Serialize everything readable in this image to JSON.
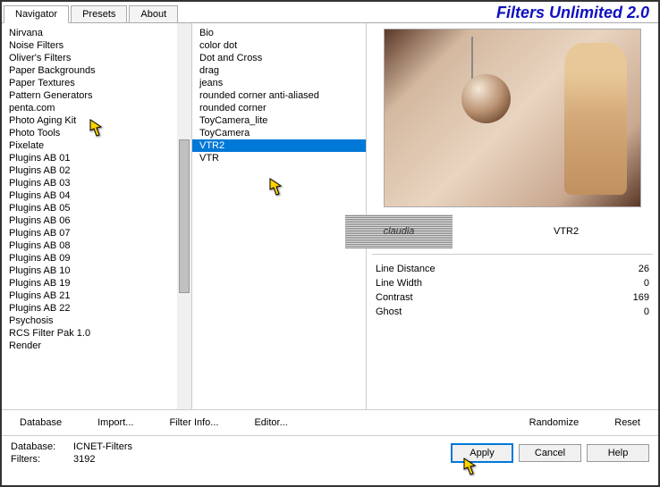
{
  "app_title": "Filters Unlimited 2.0",
  "tabs": [
    "Navigator",
    "Presets",
    "About"
  ],
  "active_tab": 0,
  "categories": [
    "Nirvana",
    "Noise Filters",
    "Oliver's Filters",
    "Paper Backgrounds",
    "Paper Textures",
    "Pattern Generators",
    "penta.com",
    "Photo Aging Kit",
    "Photo Tools",
    "Pixelate",
    "Plugins AB 01",
    "Plugins AB 02",
    "Plugins AB 03",
    "Plugins AB 04",
    "Plugins AB 05",
    "Plugins AB 06",
    "Plugins AB 07",
    "Plugins AB 08",
    "Plugins AB 09",
    "Plugins AB 10",
    "Plugins AB 19",
    "Plugins AB 21",
    "Plugins AB 22",
    "Psychosis",
    "RCS Filter Pak 1.0",
    "Render"
  ],
  "filters": [
    "Bio",
    "color dot",
    "Dot and Cross",
    "drag",
    "jeans",
    "rounded corner anti-aliased",
    "rounded corner",
    "ToyCamera_lite",
    "ToyCamera",
    "VTR2",
    "VTR"
  ],
  "selected_filter_index": 9,
  "current_filter": "VTR2",
  "watermark": "claudia",
  "params": [
    {
      "name": "Line Distance",
      "value": 26
    },
    {
      "name": "Line Width",
      "value": 0
    },
    {
      "name": "Contrast",
      "value": 169
    },
    {
      "name": "Ghost",
      "value": 0
    }
  ],
  "toolbar": {
    "database": "Database",
    "import": "Import...",
    "filter_info": "Filter Info...",
    "editor": "Editor...",
    "randomize": "Randomize",
    "reset": "Reset"
  },
  "footer": {
    "database_label": "Database:",
    "database_value": "ICNET-Filters",
    "filters_label": "Filters:",
    "filters_value": "3192",
    "apply": "Apply",
    "cancel": "Cancel",
    "help": "Help"
  }
}
